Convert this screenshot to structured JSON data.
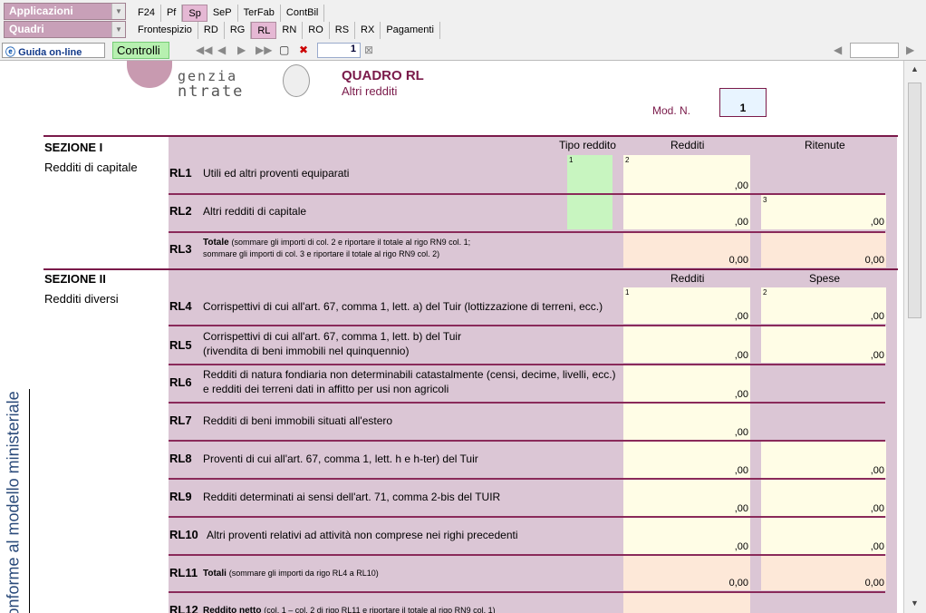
{
  "top": {
    "combo1": "Applicazioni",
    "combo2": "Quadri",
    "row1_tabs": [
      "F24",
      "Pf",
      "Sp",
      "SeP",
      "TerFab",
      "ContBil"
    ],
    "row2_tabs": [
      "Frontespizio",
      "RD",
      "RG",
      "RL",
      "RN",
      "RO",
      "RS",
      "RX",
      "Pagamenti"
    ]
  },
  "toolbar": {
    "guida": "Guida on-line",
    "controlli": "Controlli",
    "page": "1"
  },
  "doc": {
    "logo_top": "genzia",
    "logo_bottom": "ntrate",
    "quadro": "QUADRO RL",
    "quadro_sub": "Altri redditi",
    "mod_label": "Mod. N.",
    "mod_value": "1",
    "side_text": "onforme al modello ministeriale",
    "sez1_title": "SEZIONE I",
    "sez1_sub": "Redditi di capitale",
    "sez2_title": "SEZIONE II",
    "sez2_sub": "Redditi diversi",
    "h_tipo": "Tipo reddito",
    "h_redditi": "Redditi",
    "h_ritenute": "Ritenute",
    "h2_redditi": "Redditi",
    "h2_spese": "Spese",
    "zero": ",00",
    "zero_tot": "0,00",
    "rows": [
      {
        "code": "RL1",
        "d1": "Utili ed altri proventi equiparati"
      },
      {
        "code": "RL2",
        "d1": "Altri redditi di capitale"
      },
      {
        "code": "RL3",
        "d1": "Totale",
        "d2": "(sommare gli importi di col. 2 e riportare il totale al rigo RN9 col. 1;",
        "d3": "sommare gli importi di col. 3 e riportare il totale al rigo RN9 col. 2)"
      },
      {
        "code": "RL4",
        "d1": "Corrispettivi di cui all'art. 67, comma 1, lett. a) del Tuir (lottizzazione di terreni, ecc.)"
      },
      {
        "code": "RL5",
        "d1": "Corrispettivi di cui all'art. 67, comma 1, lett. b) del Tuir",
        "d2": "(rivendita di beni immobili nel quinquennio)"
      },
      {
        "code": "RL6",
        "d1": "Redditi di natura fondiaria non determinabili catastalmente (censi, decime, livelli, ecc.)",
        "d2": "e redditi dei terreni dati in affitto per usi non agricoli"
      },
      {
        "code": "RL7",
        "d1": "Redditi di beni immobili situati all'estero"
      },
      {
        "code": "RL8",
        "d1": "Proventi di cui all'art. 67, comma 1, lett. h e h-ter) del Tuir"
      },
      {
        "code": "RL9",
        "d1": "Redditi determinati ai sensi dell'art. 71, comma 2-bis del TUIR"
      },
      {
        "code": "RL10",
        "d1": "Altri proventi relativi ad attività non comprese nei righi precedenti"
      },
      {
        "code": "RL11",
        "d1": "Totali",
        "d2": "(sommare gli importi da rigo RL4 a RL10)"
      },
      {
        "code": "RL12",
        "d1": "Reddito netto",
        "d2": "(col. 1 – col. 2 di rigo RL11 e riportare il totale al rigo RN9 col. 1)"
      }
    ]
  },
  "colors": {
    "band": "#dbc6d5",
    "accent": "#8a2a5a"
  }
}
